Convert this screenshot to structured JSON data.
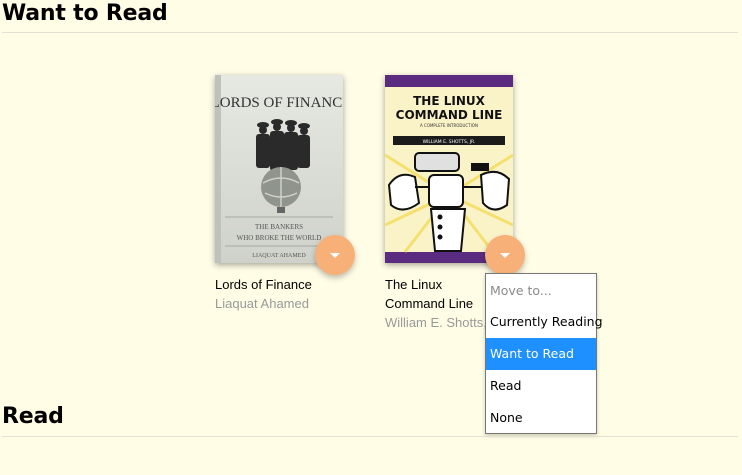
{
  "shelves": {
    "want_to_read": {
      "title": "Want to Read"
    },
    "read": {
      "title": "Read"
    }
  },
  "books": [
    {
      "title": "Lords of Finance",
      "author": "Liaquat Ahamed",
      "cover": {
        "title": "LORDS OF FINANCE",
        "subtitle_line1": "THE BANKERS",
        "subtitle_line2": "WHO BROKE THE WORLD",
        "author": "LIAQUAT AHAMED"
      }
    },
    {
      "title": "The Linux Command Line",
      "author": "William E. Shotts, Jr.",
      "cover": {
        "title_line1": "THE LINUX",
        "title_line2": "COMMAND LINE",
        "tagline": "A COMPLETE INTRODUCTION",
        "author": "WILLIAM E. SHOTTS, JR."
      }
    }
  ],
  "shelf_menu": {
    "options": [
      "Move to...",
      "Currently Reading",
      "Want to Read",
      "Read",
      "None"
    ],
    "selected": "Want to Read"
  },
  "colors": {
    "background": "#fffde6",
    "changer": "#f7b178",
    "menu_selected": "#1e90ff",
    "linux_cover_purple": "#5b2b80"
  }
}
